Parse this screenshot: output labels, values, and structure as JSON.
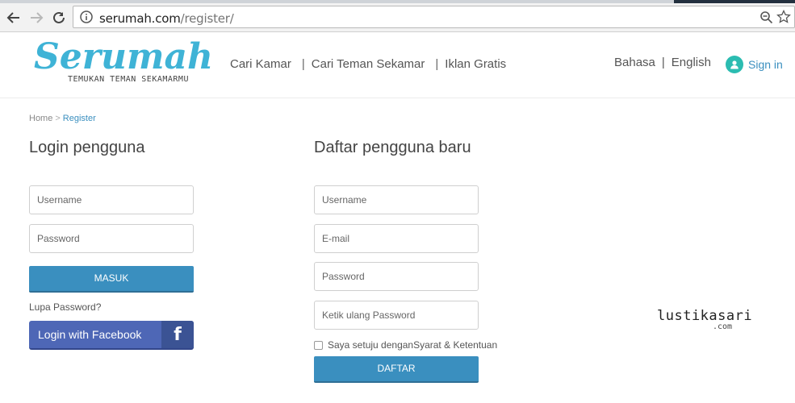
{
  "browser": {
    "url_host": "serumah.com",
    "url_path": "/register/",
    "icons": {
      "back": "arrow-left-icon",
      "forward": "arrow-right-icon",
      "reload": "reload-icon",
      "info": "info-icon",
      "zoom": "zoom-icon",
      "bookmark": "star-icon"
    }
  },
  "header": {
    "logo_text": "Serumah",
    "logo_tagline": "TEMUKAN TEMAN SEKAMARMU",
    "nav": [
      {
        "label": "Cari Kamar"
      },
      {
        "sep": "|",
        "label": "Cari Teman Sekamar"
      },
      {
        "sep": "|",
        "label": "Iklan Gratis"
      }
    ],
    "lang": {
      "bahasa": "Bahasa",
      "sep": "|",
      "english": "English"
    },
    "signin_label": "Sign in"
  },
  "breadcrumb": {
    "home": "Home",
    "sep": ">",
    "current": "Register"
  },
  "login": {
    "title": "Login pengguna",
    "username_placeholder": "Username",
    "password_placeholder": "Password",
    "submit": "MASUK",
    "forgot": "Lupa Password?",
    "facebook": "Login with Facebook",
    "facebook_icon_letter": "f"
  },
  "register": {
    "title": "Daftar pengguna baru",
    "username_placeholder": "Username",
    "email_placeholder": "E-mail",
    "password_placeholder": "Password",
    "confirm_placeholder": "Ketik ulang Password",
    "agree": "Saya setuju denganSyarat & Ketentuan",
    "submit": "DAFTAR"
  },
  "watermark": {
    "main": "lustikasari",
    "sub": ".com"
  },
  "colors": {
    "primary": "#3a8fbf",
    "facebook": "#4e67b6",
    "logo": "#3fb3d6",
    "signin": "#2bbcb1"
  }
}
